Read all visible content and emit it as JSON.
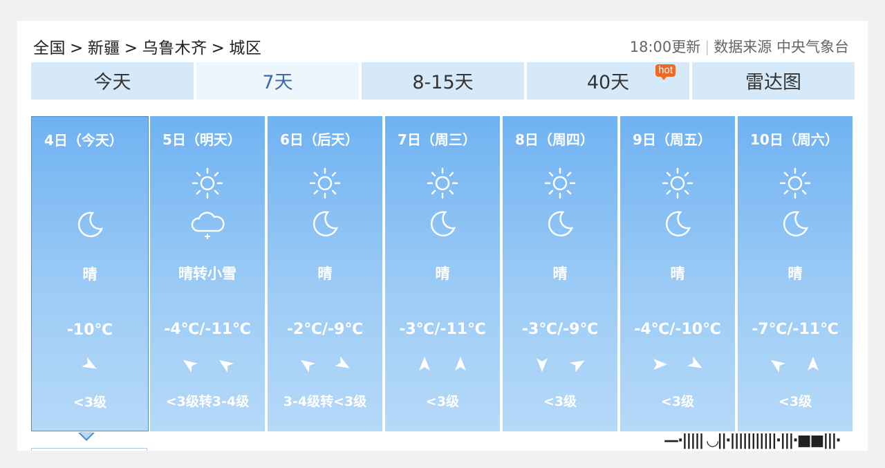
{
  "breadcrumb": {
    "items": [
      "全国",
      "新疆",
      "乌鲁木齐",
      "城区"
    ],
    "separator": ">"
  },
  "meta": {
    "update": "18:00更新",
    "source": "数据来源 中央气象台"
  },
  "tabs": [
    {
      "label": "今天",
      "active": false,
      "hot": false
    },
    {
      "label": "7天",
      "active": true,
      "hot": false
    },
    {
      "label": "8-15天",
      "active": false,
      "hot": false
    },
    {
      "label": "40天",
      "active": false,
      "hot": true
    },
    {
      "label": "雷达图",
      "active": false,
      "hot": false
    }
  ],
  "hot_badge": "hot",
  "days": [
    {
      "date": "4日（今天）",
      "day_icon": "none",
      "night_icon": "moon-icon",
      "weather": "晴",
      "temp": "-10℃",
      "winds": [
        "wind-arrow-icon"
      ],
      "level": "<3级"
    },
    {
      "date": "5日（明天）",
      "day_icon": "sun-icon",
      "night_icon": "light-snow-icon",
      "weather": "晴转小雪",
      "temp": "-4℃/-11℃",
      "winds": [
        "wind-arrow-icon",
        "wind-arrow-icon"
      ],
      "level": "<3级转3-4级"
    },
    {
      "date": "6日（后天）",
      "day_icon": "sun-icon",
      "night_icon": "moon-icon",
      "weather": "晴",
      "temp": "-2℃/-9℃",
      "winds": [
        "wind-arrow-icon",
        "wind-arrow-icon"
      ],
      "level": "3-4级转<3级"
    },
    {
      "date": "7日（周三）",
      "day_icon": "sun-icon",
      "night_icon": "moon-icon",
      "weather": "晴",
      "temp": "-3℃/-11℃",
      "winds": [
        "wind-arrow-icon",
        "wind-arrow-icon"
      ],
      "level": "<3级"
    },
    {
      "date": "8日（周四）",
      "day_icon": "sun-icon",
      "night_icon": "moon-icon",
      "weather": "晴",
      "temp": "-3℃/-9℃",
      "winds": [
        "wind-arrow-icon",
        "wind-arrow-icon"
      ],
      "level": "<3级"
    },
    {
      "date": "9日（周五）",
      "day_icon": "sun-icon",
      "night_icon": "moon-icon",
      "weather": "晴",
      "temp": "-4℃/-10℃",
      "winds": [
        "wind-arrow-icon",
        "wind-arrow-icon"
      ],
      "level": "<3级"
    },
    {
      "date": "10日（周六）",
      "day_icon": "sun-icon",
      "night_icon": "moon-icon",
      "weather": "晴",
      "temp": "-7℃/-11℃",
      "winds": [
        "wind-arrow-icon",
        "wind-arrow-icon"
      ],
      "level": "<3级"
    }
  ],
  "colors": {
    "card_top": "#6fb2f2",
    "card_bottom": "#b6d9f8",
    "tab_bg": "#d6e9f9",
    "tab_active_text": "#3e6aa8",
    "hot": "#f06a23"
  }
}
